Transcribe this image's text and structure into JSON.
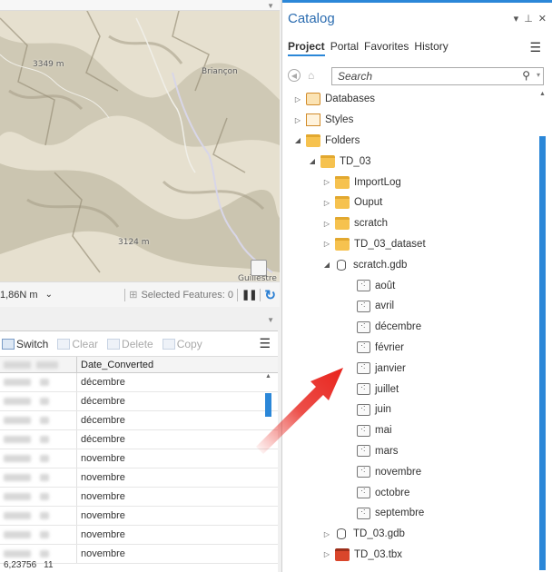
{
  "map": {
    "labels": [
      "3349 m",
      "Briançon",
      "3124 m",
      "Guillestre"
    ],
    "scale": "1,86N m",
    "selected_features": "Selected Features: 0"
  },
  "attribute_table": {
    "toolbar": {
      "switch": "Switch",
      "clear": "Clear",
      "delete": "Delete",
      "copy": "Copy"
    },
    "date_column_header": "Date_Converted",
    "rows": [
      "décembre",
      "décembre",
      "décembre",
      "décembre",
      "novembre",
      "novembre",
      "novembre",
      "novembre",
      "novembre",
      "novembre"
    ],
    "last_row_values": [
      "6,23756",
      "11"
    ]
  },
  "catalog": {
    "title": "Catalog",
    "tabs": [
      "Project",
      "Portal",
      "Favorites",
      "History"
    ],
    "active_tab": "Project",
    "search_placeholder": "Search",
    "tree": [
      {
        "label": "Databases",
        "icon": "database-icon",
        "twisty": "▷"
      },
      {
        "label": "Styles",
        "icon": "styles-icon",
        "twisty": "▷"
      },
      {
        "label": "Folders",
        "icon": "folder-icon",
        "twisty": "◢"
      },
      {
        "label": "TD_03",
        "icon": "folder-icon",
        "twisty": "◢"
      },
      {
        "label": "ImportLog",
        "icon": "folder-icon",
        "twisty": "▷"
      },
      {
        "label": "Ouput",
        "icon": "folder-icon",
        "twisty": "▷"
      },
      {
        "label": "scratch",
        "icon": "folder-icon",
        "twisty": "▷"
      },
      {
        "label": "TD_03_dataset",
        "icon": "folder-icon",
        "twisty": "▷"
      },
      {
        "label": "scratch.gdb",
        "icon": "geodatabase-icon",
        "twisty": "◢"
      },
      {
        "label": "août",
        "icon": "feature-class-icon",
        "twisty": ""
      },
      {
        "label": "avril",
        "icon": "feature-class-icon",
        "twisty": ""
      },
      {
        "label": "décembre",
        "icon": "feature-class-icon",
        "twisty": ""
      },
      {
        "label": "février",
        "icon": "feature-class-icon",
        "twisty": ""
      },
      {
        "label": "janvier",
        "icon": "feature-class-icon",
        "twisty": ""
      },
      {
        "label": "juillet",
        "icon": "feature-class-icon",
        "twisty": ""
      },
      {
        "label": "juin",
        "icon": "feature-class-icon",
        "twisty": ""
      },
      {
        "label": "mai",
        "icon": "feature-class-icon",
        "twisty": ""
      },
      {
        "label": "mars",
        "icon": "feature-class-icon",
        "twisty": ""
      },
      {
        "label": "novembre",
        "icon": "feature-class-icon",
        "twisty": ""
      },
      {
        "label": "octobre",
        "icon": "feature-class-icon",
        "twisty": ""
      },
      {
        "label": "septembre",
        "icon": "feature-class-icon",
        "twisty": ""
      },
      {
        "label": "TD_03.gdb",
        "icon": "geodatabase-icon",
        "twisty": "▷"
      },
      {
        "label": "TD_03.tbx",
        "icon": "toolbox-icon",
        "twisty": "▷"
      }
    ]
  },
  "colors": {
    "accent": "#2b87d8",
    "arrow": "#e8231c",
    "title": "#2b6cb0"
  }
}
